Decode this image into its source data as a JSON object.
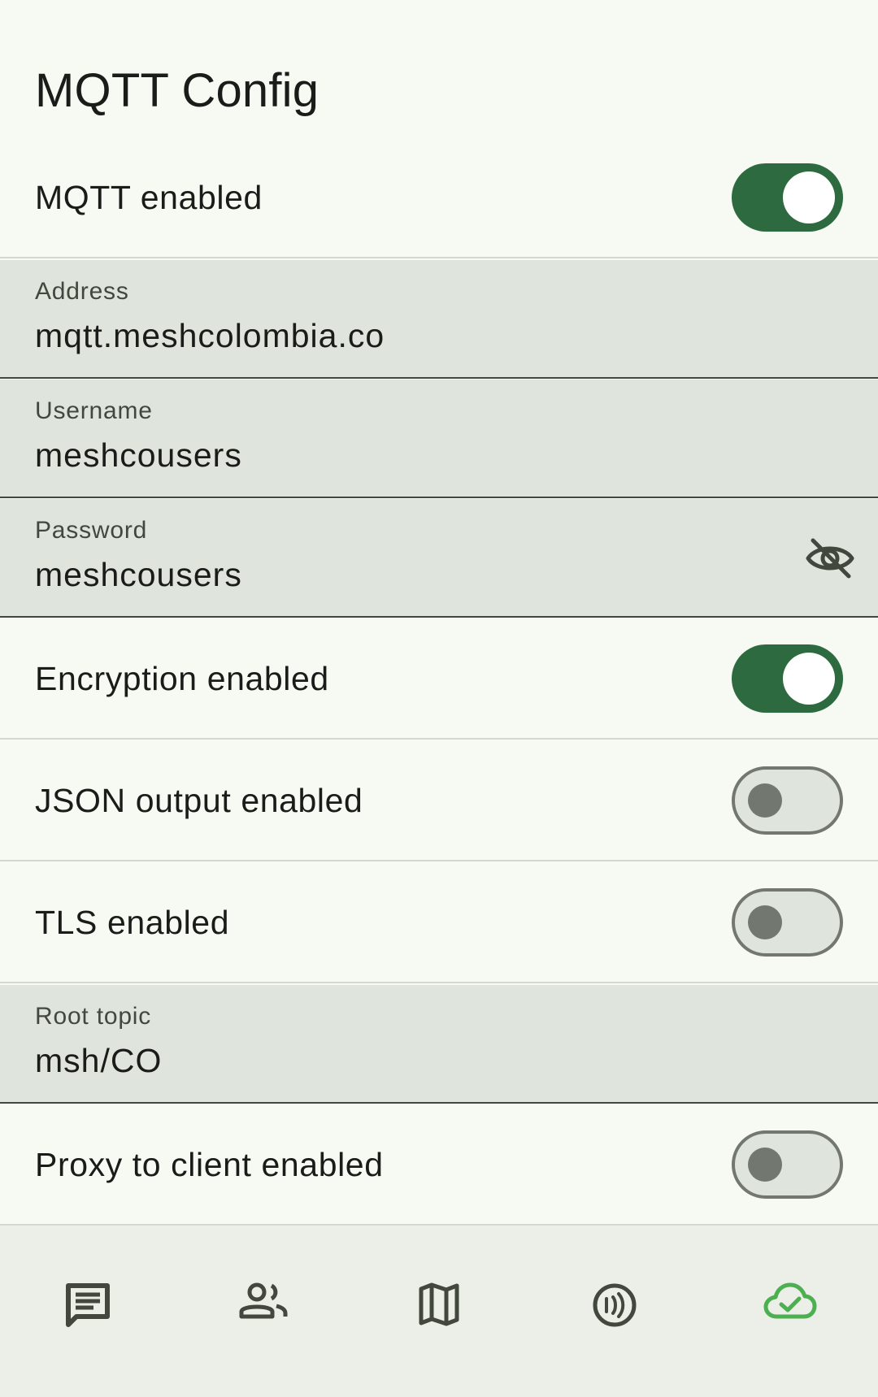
{
  "page": {
    "title": "MQTT Config"
  },
  "mqtt_enabled": {
    "label": "MQTT enabled",
    "state": "on"
  },
  "address": {
    "label": "Address",
    "value": "mqtt.meshcolombia.co"
  },
  "username": {
    "label": "Username",
    "value": "meshcousers"
  },
  "password": {
    "label": "Password",
    "value": "meshcousers",
    "icon": "visibility-off-icon"
  },
  "encryption_enabled": {
    "label": "Encryption enabled",
    "state": "on"
  },
  "json_output_enabled": {
    "label": "JSON output enabled",
    "state": "off"
  },
  "tls_enabled": {
    "label": "TLS enabled",
    "state": "off"
  },
  "root_topic": {
    "label": "Root topic",
    "value": "msh/CO"
  },
  "proxy_to_client_enabled": {
    "label": "Proxy to client enabled",
    "state": "off"
  },
  "nav": {
    "items": [
      {
        "icon": "messages-icon",
        "active": false
      },
      {
        "icon": "people-icon",
        "active": false
      },
      {
        "icon": "map-icon",
        "active": false
      },
      {
        "icon": "radio-signal-icon",
        "active": false
      },
      {
        "icon": "cloud-done-icon",
        "active": true
      }
    ]
  },
  "colors": {
    "background": "#f6faf3",
    "switch_on": "#2d6a3f",
    "switch_off_track": "#dfe4dc",
    "switch_off_outline": "#72776f",
    "field_background": "#dfe4dc",
    "nav_background": "#ebefe7",
    "nav_active": "#4caf50",
    "nav_icon": "#43483f"
  }
}
